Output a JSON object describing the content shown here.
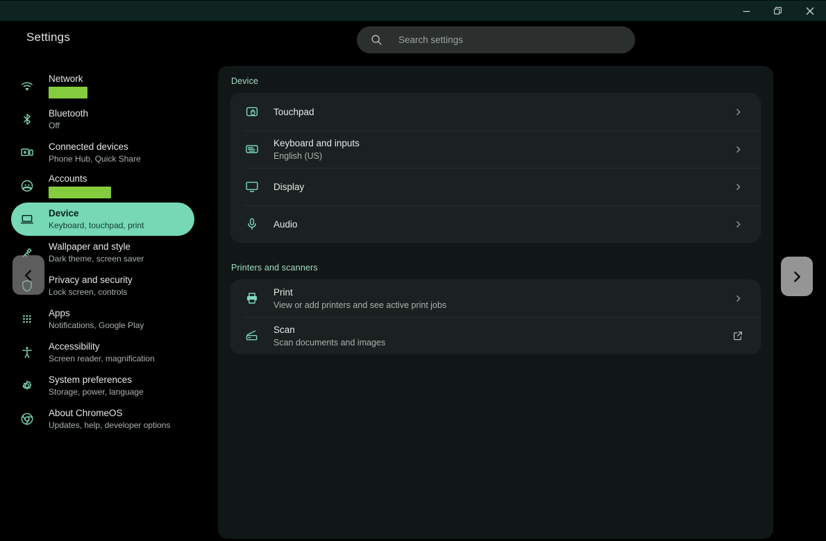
{
  "window": {
    "buttons": [
      {
        "name": "minimize",
        "label": "Minimize"
      },
      {
        "name": "restore",
        "label": "Restore"
      },
      {
        "name": "close",
        "label": "Close"
      }
    ]
  },
  "header": {
    "title": "Settings"
  },
  "search": {
    "placeholder": "Search settings",
    "value": "",
    "icon": "search-icon"
  },
  "sidebar": {
    "items": [
      {
        "label": "Network",
        "sub": "",
        "icon": "wifi-icon",
        "selected": false,
        "redacted": true,
        "redact_width": 56
      },
      {
        "label": "Bluetooth",
        "sub": "Off",
        "icon": "bluetooth-icon",
        "selected": false,
        "redacted": false
      },
      {
        "label": "Connected devices",
        "sub": "Phone Hub, Quick Share",
        "icon": "connected-devices-icon",
        "selected": false,
        "redacted": false
      },
      {
        "label": "Accounts",
        "sub": "",
        "icon": "account-icon",
        "selected": false,
        "redacted": true,
        "redact_width": 90
      },
      {
        "label": "Device",
        "sub": "Keyboard, touchpad, print",
        "icon": "laptop-icon",
        "selected": true,
        "redacted": false
      },
      {
        "label": "Wallpaper and style",
        "sub": "Dark theme, screen saver",
        "icon": "wallpaper-icon",
        "selected": false,
        "redacted": false
      },
      {
        "label": "Privacy and security",
        "sub": "Lock screen, controls",
        "icon": "shield-icon",
        "selected": false,
        "redacted": false
      },
      {
        "label": "Apps",
        "sub": "Notifications, Google Play",
        "icon": "apps-grid-icon",
        "selected": false,
        "redacted": false
      },
      {
        "label": "Accessibility",
        "sub": "Screen reader, magnification",
        "icon": "accessibility-icon",
        "selected": false,
        "redacted": false
      },
      {
        "label": "System preferences",
        "sub": "Storage, power, language",
        "icon": "gear-icon",
        "selected": false,
        "redacted": false
      },
      {
        "label": "About ChromeOS",
        "sub": "Updates, help, developer options",
        "icon": "chrome-icon",
        "selected": false,
        "redacted": false
      }
    ]
  },
  "main": {
    "sections": [
      {
        "title": "Device",
        "rows": [
          {
            "label": "Touchpad",
            "sub": "",
            "icon": "touchpad-icon",
            "trailing": "chevron-right-icon"
          },
          {
            "label": "Keyboard and inputs",
            "sub": "English (US)",
            "icon": "keyboard-icon",
            "trailing": "chevron-right-icon"
          },
          {
            "label": "Display",
            "sub": "",
            "icon": "display-icon",
            "trailing": "chevron-right-icon"
          },
          {
            "label": "Audio",
            "sub": "",
            "icon": "microphone-icon",
            "trailing": "chevron-right-icon"
          }
        ]
      },
      {
        "title": "Printers and scanners",
        "rows": [
          {
            "label": "Print",
            "sub": "View or add printers and see active print jobs",
            "icon": "printer-icon",
            "trailing": "chevron-right-icon"
          },
          {
            "label": "Scan",
            "sub": "Scan documents and images",
            "icon": "scanner-icon",
            "trailing": "external-link-icon"
          }
        ]
      }
    ]
  },
  "overlay": {
    "back_arrow": {
      "name": "previous-page-arrow",
      "icon": "chevron-left-icon"
    },
    "forward_arrow": {
      "name": "next-page-arrow",
      "icon": "chevron-right-icon"
    }
  },
  "colors": {
    "background": "#000000",
    "titlebar": "#0d2420",
    "card": "#111716",
    "group": "#1a2120",
    "accent_selected": "#76d8b5",
    "icon_teal": "#7fd8bb",
    "section_header": "#a5ddc6",
    "redaction": "#84cb3d"
  }
}
